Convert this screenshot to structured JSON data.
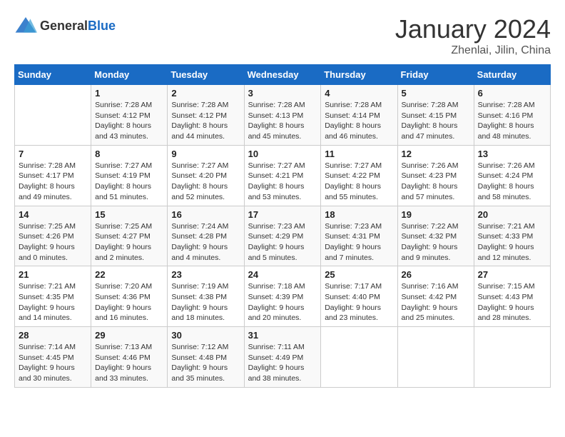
{
  "header": {
    "logo_general": "General",
    "logo_blue": "Blue",
    "month": "January 2024",
    "location": "Zhenlai, Jilin, China"
  },
  "days_of_week": [
    "Sunday",
    "Monday",
    "Tuesday",
    "Wednesday",
    "Thursday",
    "Friday",
    "Saturday"
  ],
  "weeks": [
    [
      {
        "day": "",
        "info": ""
      },
      {
        "day": "1",
        "info": "Sunrise: 7:28 AM\nSunset: 4:12 PM\nDaylight: 8 hours\nand 43 minutes."
      },
      {
        "day": "2",
        "info": "Sunrise: 7:28 AM\nSunset: 4:12 PM\nDaylight: 8 hours\nand 44 minutes."
      },
      {
        "day": "3",
        "info": "Sunrise: 7:28 AM\nSunset: 4:13 PM\nDaylight: 8 hours\nand 45 minutes."
      },
      {
        "day": "4",
        "info": "Sunrise: 7:28 AM\nSunset: 4:14 PM\nDaylight: 8 hours\nand 46 minutes."
      },
      {
        "day": "5",
        "info": "Sunrise: 7:28 AM\nSunset: 4:15 PM\nDaylight: 8 hours\nand 47 minutes."
      },
      {
        "day": "6",
        "info": "Sunrise: 7:28 AM\nSunset: 4:16 PM\nDaylight: 8 hours\nand 48 minutes."
      }
    ],
    [
      {
        "day": "7",
        "info": "Sunrise: 7:28 AM\nSunset: 4:17 PM\nDaylight: 8 hours\nand 49 minutes."
      },
      {
        "day": "8",
        "info": "Sunrise: 7:27 AM\nSunset: 4:19 PM\nDaylight: 8 hours\nand 51 minutes."
      },
      {
        "day": "9",
        "info": "Sunrise: 7:27 AM\nSunset: 4:20 PM\nDaylight: 8 hours\nand 52 minutes."
      },
      {
        "day": "10",
        "info": "Sunrise: 7:27 AM\nSunset: 4:21 PM\nDaylight: 8 hours\nand 53 minutes."
      },
      {
        "day": "11",
        "info": "Sunrise: 7:27 AM\nSunset: 4:22 PM\nDaylight: 8 hours\nand 55 minutes."
      },
      {
        "day": "12",
        "info": "Sunrise: 7:26 AM\nSunset: 4:23 PM\nDaylight: 8 hours\nand 57 minutes."
      },
      {
        "day": "13",
        "info": "Sunrise: 7:26 AM\nSunset: 4:24 PM\nDaylight: 8 hours\nand 58 minutes."
      }
    ],
    [
      {
        "day": "14",
        "info": "Sunrise: 7:25 AM\nSunset: 4:26 PM\nDaylight: 9 hours\nand 0 minutes."
      },
      {
        "day": "15",
        "info": "Sunrise: 7:25 AM\nSunset: 4:27 PM\nDaylight: 9 hours\nand 2 minutes."
      },
      {
        "day": "16",
        "info": "Sunrise: 7:24 AM\nSunset: 4:28 PM\nDaylight: 9 hours\nand 4 minutes."
      },
      {
        "day": "17",
        "info": "Sunrise: 7:23 AM\nSunset: 4:29 PM\nDaylight: 9 hours\nand 5 minutes."
      },
      {
        "day": "18",
        "info": "Sunrise: 7:23 AM\nSunset: 4:31 PM\nDaylight: 9 hours\nand 7 minutes."
      },
      {
        "day": "19",
        "info": "Sunrise: 7:22 AM\nSunset: 4:32 PM\nDaylight: 9 hours\nand 9 minutes."
      },
      {
        "day": "20",
        "info": "Sunrise: 7:21 AM\nSunset: 4:33 PM\nDaylight: 9 hours\nand 12 minutes."
      }
    ],
    [
      {
        "day": "21",
        "info": "Sunrise: 7:21 AM\nSunset: 4:35 PM\nDaylight: 9 hours\nand 14 minutes."
      },
      {
        "day": "22",
        "info": "Sunrise: 7:20 AM\nSunset: 4:36 PM\nDaylight: 9 hours\nand 16 minutes."
      },
      {
        "day": "23",
        "info": "Sunrise: 7:19 AM\nSunset: 4:38 PM\nDaylight: 9 hours\nand 18 minutes."
      },
      {
        "day": "24",
        "info": "Sunrise: 7:18 AM\nSunset: 4:39 PM\nDaylight: 9 hours\nand 20 minutes."
      },
      {
        "day": "25",
        "info": "Sunrise: 7:17 AM\nSunset: 4:40 PM\nDaylight: 9 hours\nand 23 minutes."
      },
      {
        "day": "26",
        "info": "Sunrise: 7:16 AM\nSunset: 4:42 PM\nDaylight: 9 hours\nand 25 minutes."
      },
      {
        "day": "27",
        "info": "Sunrise: 7:15 AM\nSunset: 4:43 PM\nDaylight: 9 hours\nand 28 minutes."
      }
    ],
    [
      {
        "day": "28",
        "info": "Sunrise: 7:14 AM\nSunset: 4:45 PM\nDaylight: 9 hours\nand 30 minutes."
      },
      {
        "day": "29",
        "info": "Sunrise: 7:13 AM\nSunset: 4:46 PM\nDaylight: 9 hours\nand 33 minutes."
      },
      {
        "day": "30",
        "info": "Sunrise: 7:12 AM\nSunset: 4:48 PM\nDaylight: 9 hours\nand 35 minutes."
      },
      {
        "day": "31",
        "info": "Sunrise: 7:11 AM\nSunset: 4:49 PM\nDaylight: 9 hours\nand 38 minutes."
      },
      {
        "day": "",
        "info": ""
      },
      {
        "day": "",
        "info": ""
      },
      {
        "day": "",
        "info": ""
      }
    ]
  ]
}
